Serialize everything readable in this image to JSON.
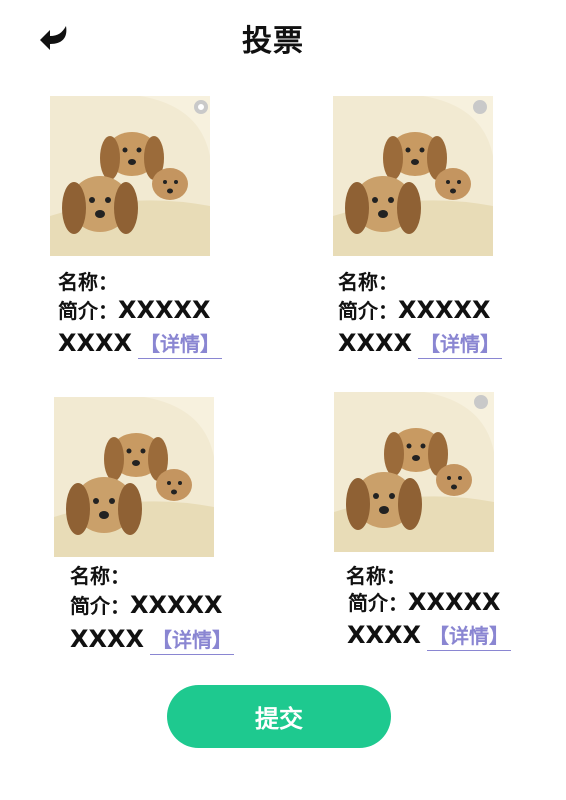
{
  "header": {
    "title": "投票"
  },
  "cards": [
    {
      "name_label": "名称：",
      "intro_label": "简介：",
      "intro_value": "XXXXX",
      "more": "XXXX",
      "detail": "【详情】",
      "selected": true
    },
    {
      "name_label": "名称：",
      "intro_label": "简介：",
      "intro_value": "XXXXX",
      "more": "XXXX",
      "detail": "【详情】",
      "selected": false
    },
    {
      "name_label": "名称：",
      "intro_label": "简介：",
      "intro_value": "XXXXX",
      "more": "XXXX",
      "detail": "【详情】",
      "selected": false
    },
    {
      "name_label": "名称：",
      "intro_label": "简介：",
      "intro_value": "XXXXX",
      "more": "XXXX",
      "detail": "【详情】",
      "selected": false
    }
  ],
  "footer": {
    "submit_label": "提交"
  },
  "colors": {
    "accent": "#1ec98f",
    "detail_link": "#8a86d2",
    "radio": "#c9c9c9"
  },
  "icons": {
    "back": "back-arrow-icon"
  }
}
